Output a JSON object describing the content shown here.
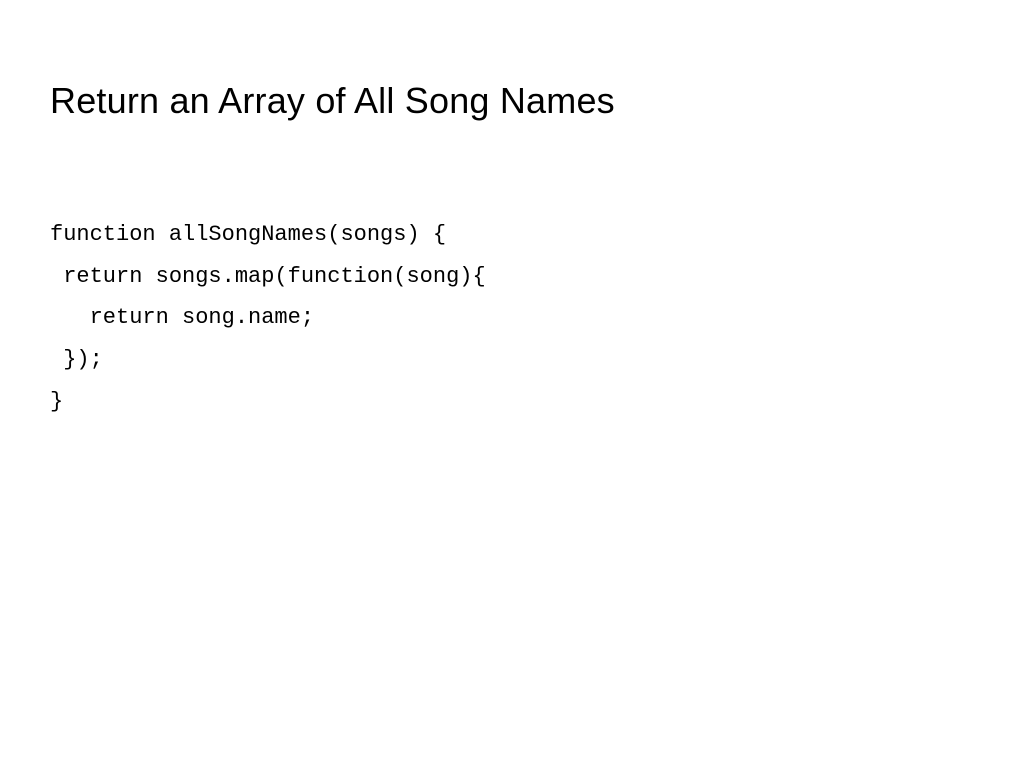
{
  "slide": {
    "title": "Return an Array of All Song Names",
    "code_lines": [
      "function allSongNames(songs) {",
      " return songs.map(function(song){",
      "   return song.name;",
      " });",
      "}"
    ]
  }
}
